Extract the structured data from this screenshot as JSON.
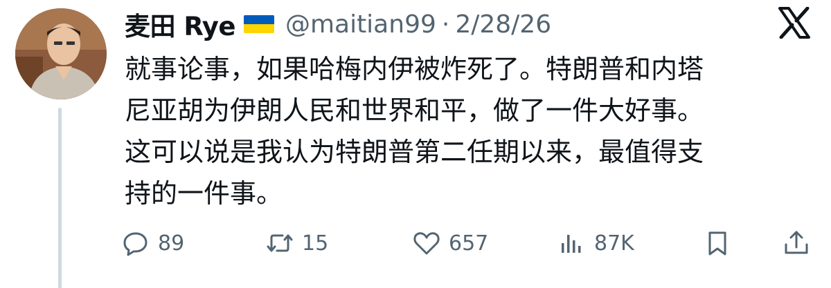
{
  "author": {
    "display_name": "麦田 Rye",
    "flag": "ukraine-flag",
    "handle": "@maitian99",
    "separator": "·",
    "date": "2/28/26"
  },
  "platform_logo": "x-logo-icon",
  "tweet": {
    "lines": [
      "就事论事，如果哈梅内伊被炸死了。特朗普和内塔",
      "尼亚胡为伊朗人民和世界和平，做了一件大好事。",
      "这可以说是我认为特朗普第二任期以来，最值得支",
      "持的一件事。"
    ]
  },
  "actions": {
    "replies": "89",
    "reposts": "15",
    "likes": "657",
    "views": "87K"
  },
  "colors": {
    "text": "#0f1419",
    "secondary": "#536471",
    "thread_line": "#cfd9de",
    "flag_blue": "#005bbb",
    "flag_yellow": "#ffd500"
  }
}
